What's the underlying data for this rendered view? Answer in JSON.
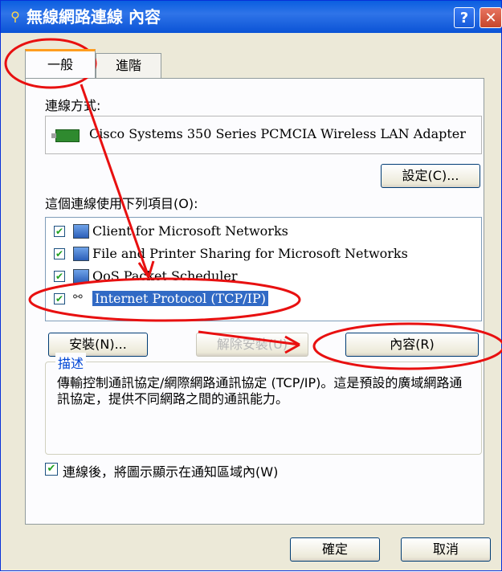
{
  "window": {
    "title": "無線網路連線 內容",
    "help_label": "?",
    "close_label": "✕"
  },
  "tabs": [
    {
      "label": "一般",
      "selected": true
    },
    {
      "label": "進階",
      "selected": false
    }
  ],
  "connect_using": {
    "label": "連線方式:",
    "adapter_name": "Cisco Systems 350 Series PCMCIA Wireless LAN Adapter",
    "adapter_icon": "network-card-icon",
    "configure_button": "設定(C)..."
  },
  "components": {
    "label": "這個連線使用下列項目(O):",
    "items": [
      {
        "label": "Client for Microsoft Networks",
        "checked": true,
        "icon": "network-client-icon",
        "selected": false
      },
      {
        "label": "File and Printer Sharing for Microsoft Networks",
        "checked": true,
        "icon": "file-printer-sharing-icon",
        "selected": false
      },
      {
        "label": "QoS Packet Scheduler",
        "checked": true,
        "icon": "qos-scheduler-icon",
        "selected": false
      },
      {
        "label": "Internet Protocol (TCP/IP)",
        "checked": true,
        "icon": "protocol-icon",
        "selected": true
      }
    ]
  },
  "buttons": {
    "install": "安裝(N)...",
    "uninstall": "解除安裝(U)",
    "properties": "內容(R)",
    "ok": "確定",
    "cancel": "取消"
  },
  "description": {
    "title": "描述",
    "text": "傳輸控制通訊協定/網際網路通訊協定 (TCP/IP)。這是預設的廣域網路通訊協定，提供不同網路之間的通訊能力。"
  },
  "notify_checkbox": {
    "label": "連線後，將圖示顯示在通知區域內(W)",
    "checked": true
  },
  "colors": {
    "annotation": "#e81010",
    "selection": "#316ac5",
    "titlebar": "#0a5ee0"
  }
}
